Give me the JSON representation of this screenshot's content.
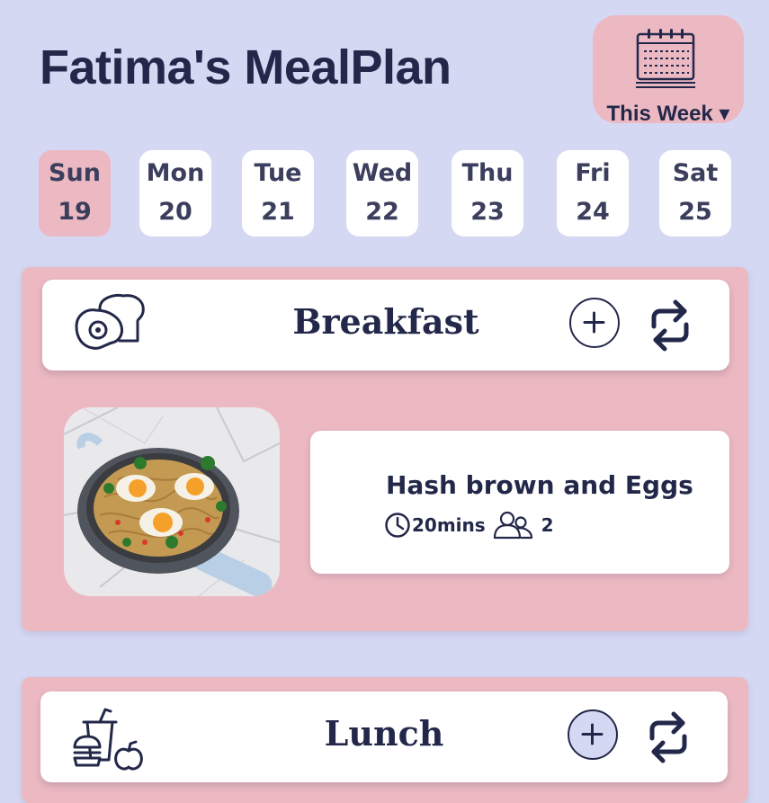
{
  "app": {
    "title": "Fatima's MealPlan"
  },
  "week_selector": {
    "label": "This Week ▾",
    "icon": "calendar-icon"
  },
  "days": [
    {
      "name": "Sun",
      "date": "19",
      "selected": true
    },
    {
      "name": "Mon",
      "date": "20",
      "selected": false
    },
    {
      "name": "Tue",
      "date": "21",
      "selected": false
    },
    {
      "name": "Wed",
      "date": "22",
      "selected": false
    },
    {
      "name": "Thu",
      "date": "23",
      "selected": false
    },
    {
      "name": "Fri",
      "date": "24",
      "selected": false
    },
    {
      "name": "Sat",
      "date": "25",
      "selected": false
    }
  ],
  "meals": {
    "breakfast": {
      "title": "Breakfast",
      "icon": "egg-toast-icon",
      "recipe": {
        "name": "Hash brown and Eggs",
        "time": "20mins",
        "servings": "2",
        "image": "skillet-hash-brown-eggs-photo"
      }
    },
    "lunch": {
      "title": "Lunch",
      "icon": "burger-drink-apple-icon"
    }
  },
  "colors": {
    "background": "#d5d8f3",
    "accent_pink": "#ecb9c2",
    "text_navy": "#23284a",
    "card_white": "#ffffff"
  }
}
